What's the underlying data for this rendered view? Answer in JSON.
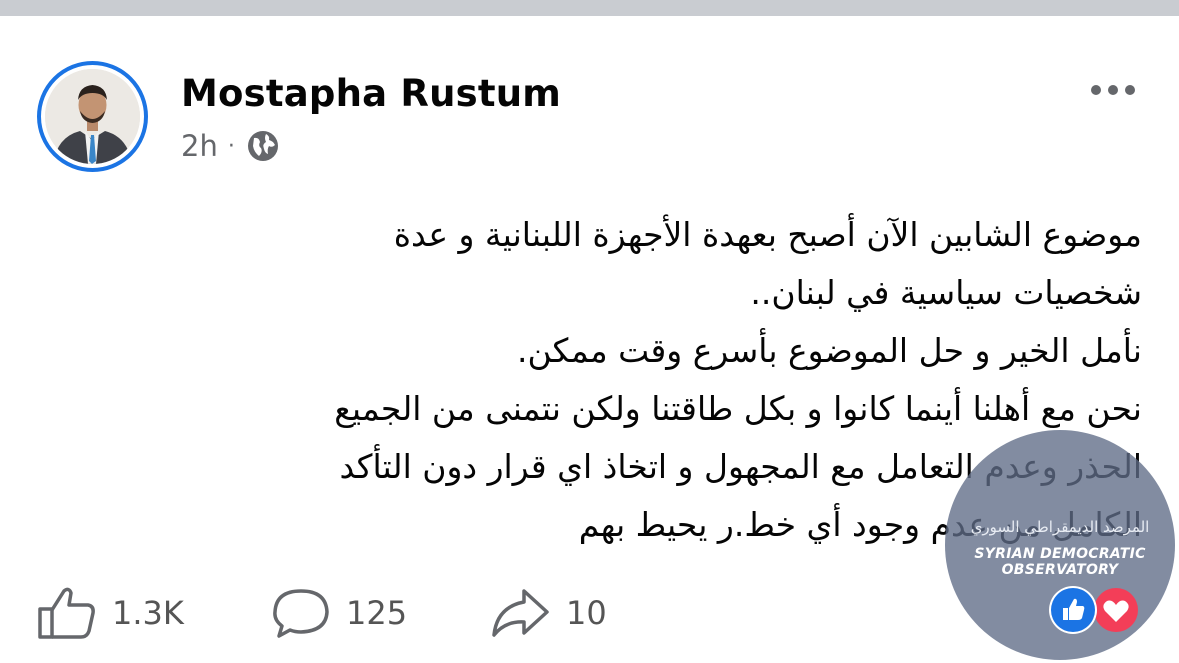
{
  "post": {
    "author": "Mostapha Rustum",
    "time": "2h",
    "separator": "·",
    "privacy_icon": "globe-icon",
    "lines": [
      "موضوع الشابين الآن أصبح بعهدة الأجهزة اللبنانية و عدة",
      "شخصيات سياسية في لبنان..",
      "نأمل الخير و حل الموضوع بأسرع وقت ممكن.",
      "نحن مع أهلنا أينما كانوا و بكل  طاقتنا ولكن نتمنى من الجميع",
      "الحذر وعدم  التعامل مع المجهول و اتخاذ اي قرار دون التأكد",
      "الكامل من عدم وجود أي خط.ر يحيط بهم"
    ]
  },
  "actions": {
    "like": {
      "icon": "thumbs-up-icon",
      "count": "1.3K"
    },
    "comment": {
      "icon": "comment-bubble-icon",
      "count": "125"
    },
    "share": {
      "icon": "share-arrow-icon",
      "count": "10"
    }
  },
  "watermark": {
    "arabic": "المرصد الديمقراطي السوري",
    "english": "SYRIAN DEMOCRATIC OBSERVATORY"
  },
  "colors": {
    "accent": "#1b74e4",
    "text": "#050505",
    "secondary": "#65676b",
    "love": "#f33e58"
  }
}
